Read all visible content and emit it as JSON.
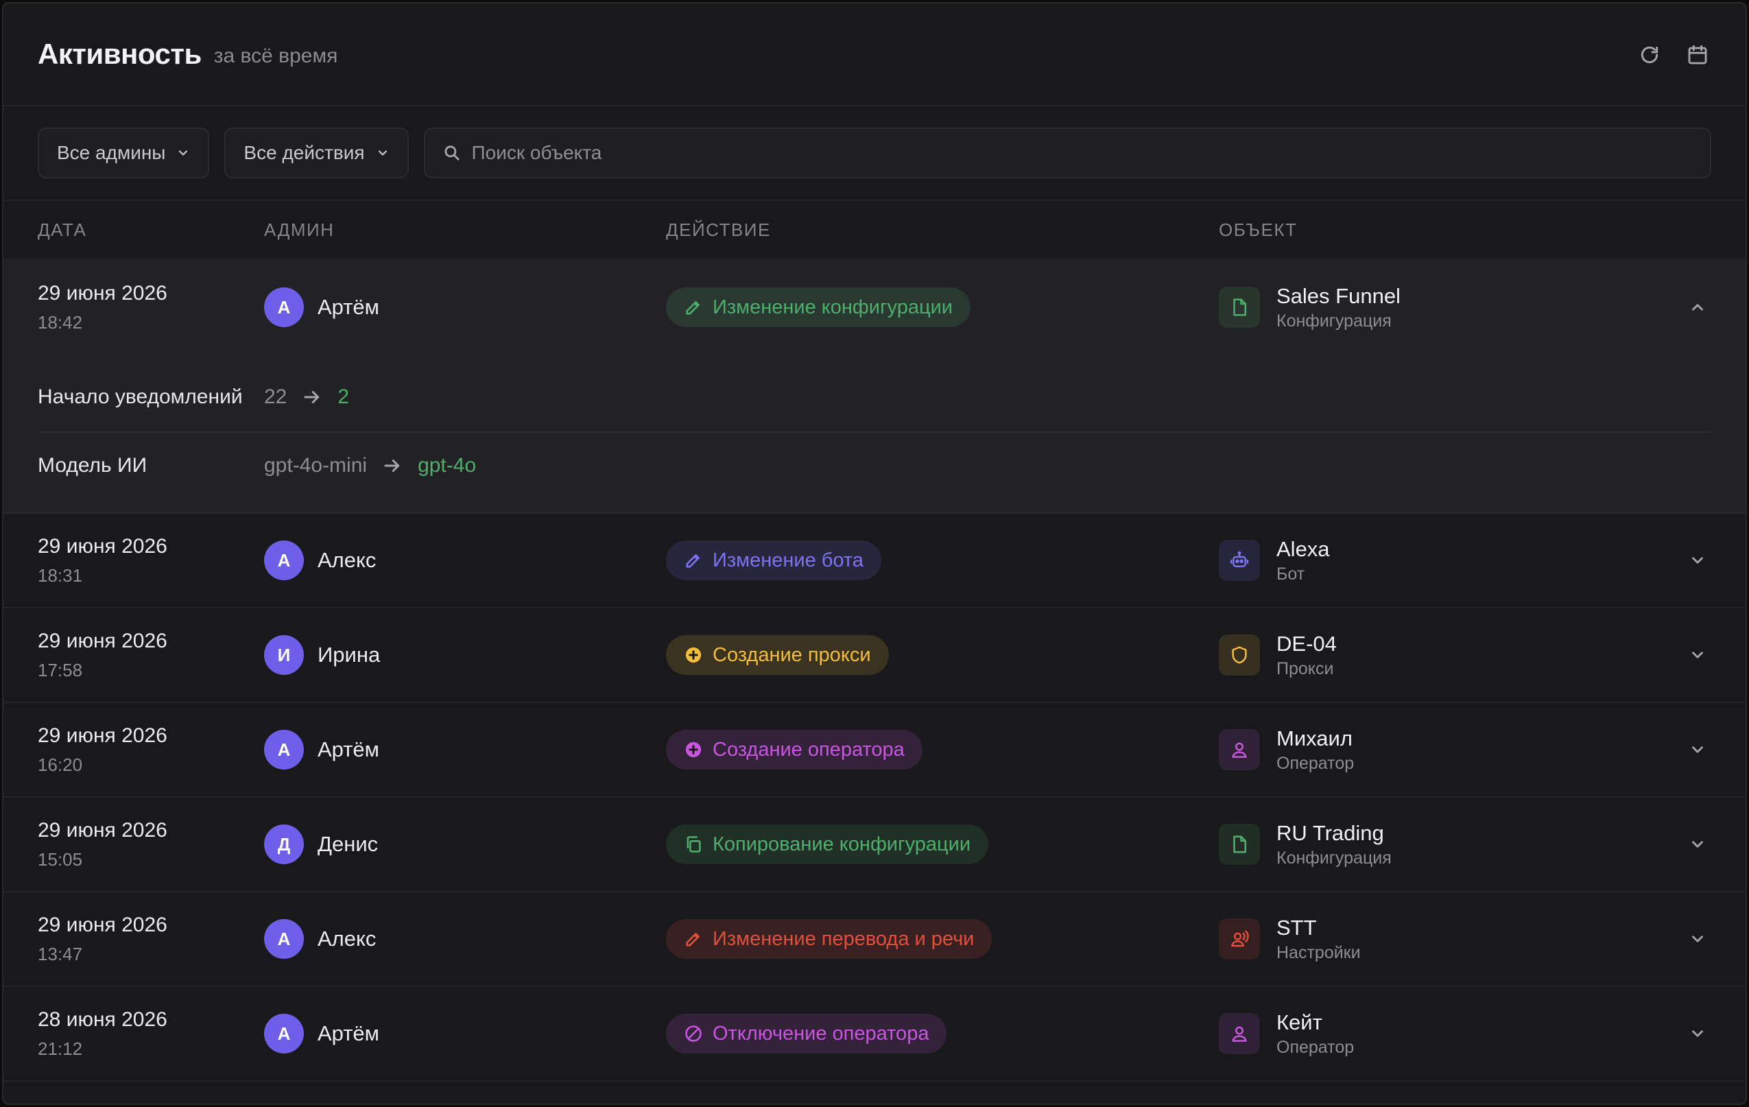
{
  "header": {
    "title": "Активность",
    "subtitle": "за всё время",
    "refresh_icon": "refresh-icon",
    "calendar_icon": "calendar-icon"
  },
  "filters": {
    "admins_label": "Все админы",
    "actions_label": "Все действия",
    "search_placeholder": "Поиск объекта",
    "search_value": ""
  },
  "columns": {
    "date": "ДАТА",
    "admin": "АДМИН",
    "action": "ДЕЙСТВИЕ",
    "object": "ОБЪЕКТ"
  },
  "colors": {
    "green": "#4fae6b",
    "blue": "#7b73f0",
    "yellow": "#f3bd3e",
    "magenta": "#c857e0",
    "red": "#e0503f",
    "avatar": "#6e5fe8"
  },
  "rows": [
    {
      "date": "29 июня 2026",
      "time": "18:42",
      "avatar": "А",
      "admin": "Артём",
      "action": "Изменение конфигурации",
      "action_icon": "pencil-icon",
      "color": "green",
      "object_name": "Sales Funnel",
      "object_type": "Конфигурация",
      "object_icon": "file-icon",
      "expanded": true,
      "details": [
        {
          "label": "Начало уведомлений",
          "old": "22",
          "new": "2"
        },
        {
          "label": "Модель ИИ",
          "old": "gpt-4o-mini",
          "new": "gpt-4o"
        }
      ]
    },
    {
      "date": "29 июня 2026",
      "time": "18:31",
      "avatar": "А",
      "admin": "Алекс",
      "action": "Изменение бота",
      "action_icon": "pencil-icon",
      "color": "blue",
      "object_name": "Alexa",
      "object_type": "Бот",
      "object_icon": "bot-icon"
    },
    {
      "date": "29 июня 2026",
      "time": "17:58",
      "avatar": "И",
      "admin": "Ирина",
      "action": "Создание прокси",
      "action_icon": "plus-circle-icon",
      "color": "yellow",
      "object_name": "DE-04",
      "object_type": "Прокси",
      "object_icon": "shield-icon"
    },
    {
      "date": "29 июня 2026",
      "time": "16:20",
      "avatar": "А",
      "admin": "Артём",
      "action": "Создание оператора",
      "action_icon": "plus-circle-icon",
      "color": "magenta",
      "object_name": "Михаил",
      "object_type": "Оператор",
      "object_icon": "user-icon"
    },
    {
      "date": "29 июня 2026",
      "time": "15:05",
      "avatar": "Д",
      "admin": "Денис",
      "action": "Копирование конфигурации",
      "action_icon": "copy-icon",
      "color": "green",
      "object_name": "RU Trading",
      "object_type": "Конфигурация",
      "object_icon": "file-icon"
    },
    {
      "date": "29 июня 2026",
      "time": "13:47",
      "avatar": "А",
      "admin": "Алекс",
      "action": "Изменение перевода и речи",
      "action_icon": "pencil-icon",
      "color": "red",
      "object_name": "STT",
      "object_type": "Настройки",
      "object_icon": "speech-icon"
    },
    {
      "date": "28 июня 2026",
      "time": "21:12",
      "avatar": "А",
      "admin": "Артём",
      "action": "Отключение оператора",
      "action_icon": "ban-icon",
      "color": "magenta",
      "object_name": "Кейт",
      "object_type": "Оператор",
      "object_icon": "user-icon"
    }
  ]
}
